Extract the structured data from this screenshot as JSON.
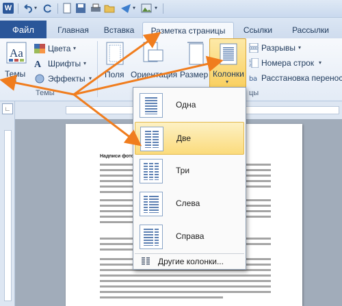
{
  "qat": {
    "logo": "W"
  },
  "tabs": [
    {
      "label": "Файл"
    },
    {
      "label": "Главная"
    },
    {
      "label": "Вставка"
    },
    {
      "label": "Разметка страницы"
    },
    {
      "label": "Ссылки"
    },
    {
      "label": "Рассылки"
    }
  ],
  "ribbon": {
    "themes_button": "Темы",
    "colors": "Цвета",
    "fonts": "Шрифты",
    "effects": "Эффекты",
    "themes_group": "Темы",
    "fields_button": "Поля",
    "orientation_button": "Ориентация",
    "size_button": "Размер",
    "columns_button": "Колонки",
    "breaks": "Разрывы",
    "line_numbers": "Номера строк",
    "hyphenation": "Расстановка переносов",
    "page_setup_group_fragment": "цы"
  },
  "document": {
    "title": "Надписи фото"
  },
  "columns_menu": {
    "items": [
      {
        "label": "Одна"
      },
      {
        "label": "Две"
      },
      {
        "label": "Три"
      },
      {
        "label": "Слева"
      },
      {
        "label": "Справа"
      }
    ],
    "more": "Другие колонки..."
  },
  "colors": {
    "file_tab": "#2a5699",
    "arrow": "#f07d1e",
    "hover": "#fbdb7c"
  }
}
